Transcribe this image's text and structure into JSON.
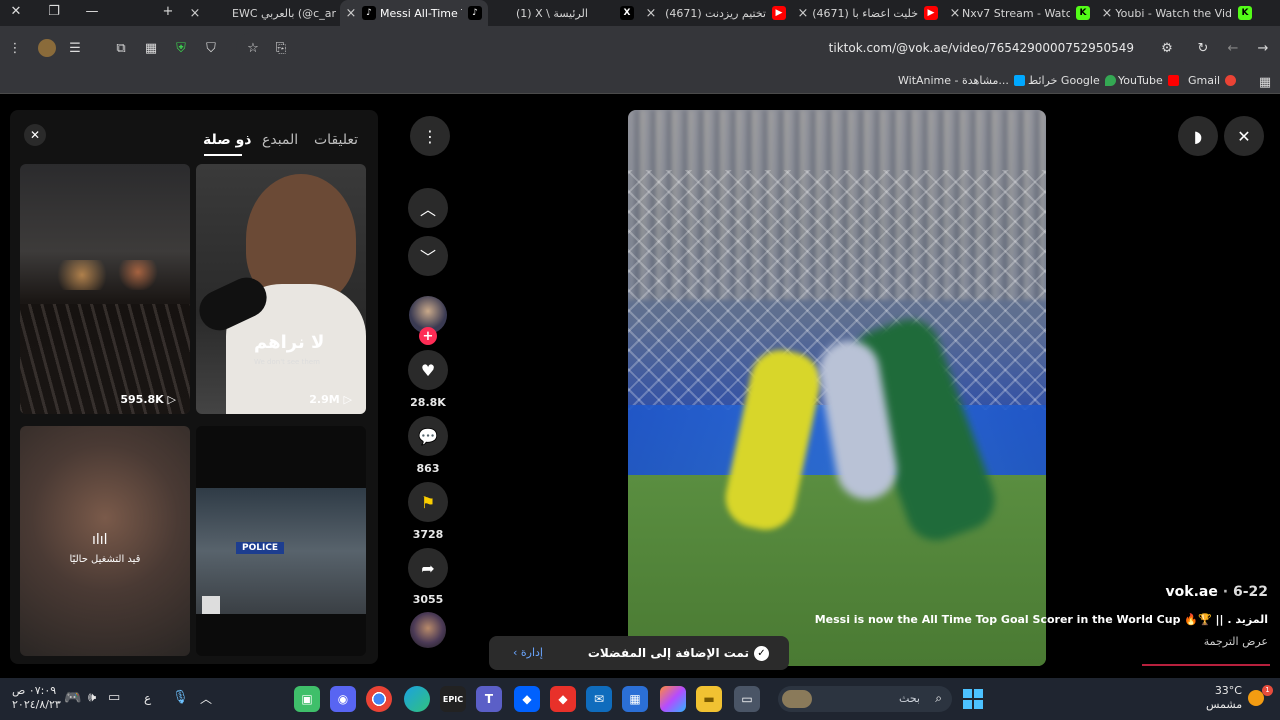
{
  "browser": {
    "tabs": [
      {
        "title": "Youbi - Watch the Vid",
        "favicon": "kick-icon",
        "color": "#53fc18"
      },
      {
        "title": "Nxv7 Stream - Watch",
        "favicon": "kick-icon",
        "color": "#53fc18"
      },
      {
        "title": "(4671) خليت اعضاء با",
        "favicon": "youtube-icon",
        "color": "#ff0000"
      },
      {
        "title": "(4671) تختيم ريزدنت",
        "favicon": "youtube-icon",
        "color": "#ff0000"
      },
      {
        "title": "(1) X \\ الرئيسة",
        "favicon": "x-icon",
        "color": "#000000"
      },
      {
        "title": "Messi All-Time To",
        "favicon": "tiktok-icon",
        "color": "#000000"
      },
      {
        "title": "EWC بالعربي (@c_ar",
        "favicon": "tiktok-icon",
        "color": "#000000"
      }
    ],
    "active_tab": 5,
    "url": "tiktok.com/@vok.ae/video/7654290000752950549",
    "bookmarks": [
      {
        "label": "Gmail",
        "color": "#ea4335"
      },
      {
        "label": "YouTube",
        "color": "#ff0000"
      },
      {
        "label": "خرائط Google",
        "color": "#34a853"
      },
      {
        "label": "WitAnime - مشاهدة...",
        "color": "#00a8ff"
      }
    ]
  },
  "panel": {
    "tabs": [
      "تعليقات",
      "المبدع",
      "ذو صلة"
    ],
    "selected_tab": "ذو صلة",
    "videos": [
      {
        "views": "2.9M",
        "overlay_ar": "لا نراهم",
        "overlay_en": "We don't see them"
      },
      {
        "views": "595.8K"
      },
      {
        "overlay_status": "قيد التشغيل حاليًا"
      },
      {
        "police_text": "POLICE"
      }
    ]
  },
  "actions": {
    "likes": "28.8K",
    "comments": "863",
    "saves": "3728",
    "shares": "3055"
  },
  "video": {
    "author": "vok.ae",
    "date": "6-22",
    "caption": "Messi is now the All Time Top Goal Scorer in the World Cup 🔥🏆 || . المزيد",
    "translate": "عرض الترجمة",
    "progress": 0.3
  },
  "toast": {
    "message": "تمت الإضافة إلى المفضلات",
    "link": "إدارة"
  },
  "taskbar": {
    "search_placeholder": "بحث",
    "temperature": "33°C",
    "weather": "مشمس",
    "time": "٠٧:٠٩ ص",
    "date": "٢٠٢٤/٨/٢٣",
    "lang": "ع"
  }
}
